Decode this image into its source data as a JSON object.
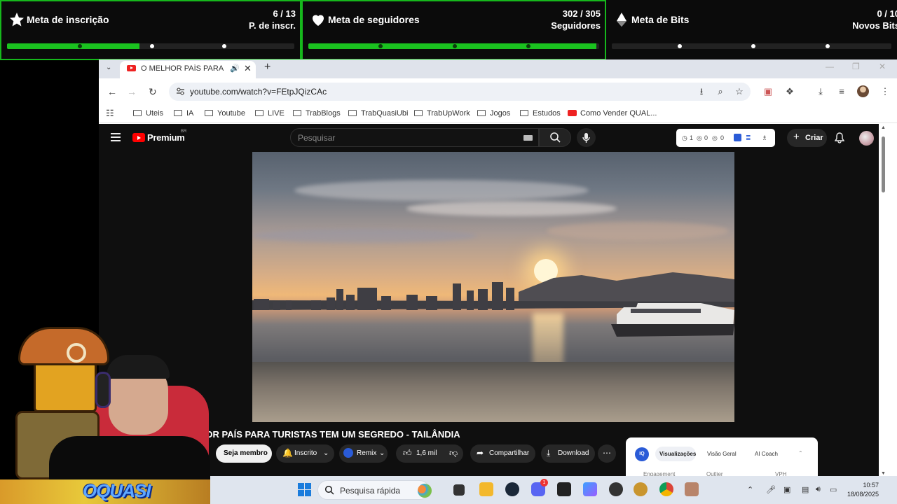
{
  "goals": {
    "subs": {
      "title": "Meta de inscrição",
      "count": "6 / 13",
      "unit": "P. de inscr.",
      "progress": 0.4615
    },
    "followers": {
      "title": "Meta de seguidores",
      "count": "302 / 305",
      "unit": "Seguidores",
      "progress": 0.99
    },
    "bits": {
      "title": "Meta de Bits",
      "count": "0 / 10",
      "unit": "Novos Bits",
      "progress": 0
    }
  },
  "browser": {
    "tab_title": "O MELHOR PAÍS PARA TURISTAS TEM UM SEGREDO - TAILÂNDIA",
    "url": "youtube.com/watch?v=FEtpJQizCAc",
    "bookmarks": [
      {
        "label": "Uteis",
        "type": "folder"
      },
      {
        "label": "IA",
        "type": "folder"
      },
      {
        "label": "Youtube",
        "type": "folder"
      },
      {
        "label": "LIVE",
        "type": "folder"
      },
      {
        "label": "TrabBlogs",
        "type": "folder"
      },
      {
        "label": "TrabQuasiUbi",
        "type": "folder"
      },
      {
        "label": "TrabUpWork",
        "type": "folder"
      },
      {
        "label": "Jogos",
        "type": "folder"
      },
      {
        "label": "Estudos",
        "type": "folder"
      },
      {
        "label": "Como Vender QUAL...",
        "type": "youtube"
      }
    ]
  },
  "youtube": {
    "brand": "Premium",
    "region": "BR",
    "search_placeholder": "Pesquisar",
    "ext_counts": [
      "1",
      "0",
      "0"
    ],
    "create_label": "Criar",
    "video_title": "HOR PAÍS PARA TURISTAS TEM UM SEGREDO - TAILÂNDIA",
    "actions": {
      "member": "Seja membro",
      "subscribed": "Inscrito",
      "remix": "Remix",
      "likes": "1,6 mil",
      "share": "Compartilhar",
      "download": "Download"
    },
    "panel": {
      "tabs": [
        "Visualizações",
        "Visão Geral",
        "AI Coach"
      ],
      "columns": [
        "Engagement",
        "Outlier",
        "VPH"
      ],
      "badge": "IQ"
    }
  },
  "overlay": {
    "logo_text": "QUASI",
    "logo_prefix": "O"
  },
  "taskbar": {
    "search_label": "Pesquisa rápida",
    "time": "10:57",
    "date": "18/08/2025",
    "discord_badge": "1"
  },
  "colors": {
    "goal_green": "#1ac21f",
    "yt_red": "#ff0000",
    "accent_blue": "#1a7cdc"
  }
}
